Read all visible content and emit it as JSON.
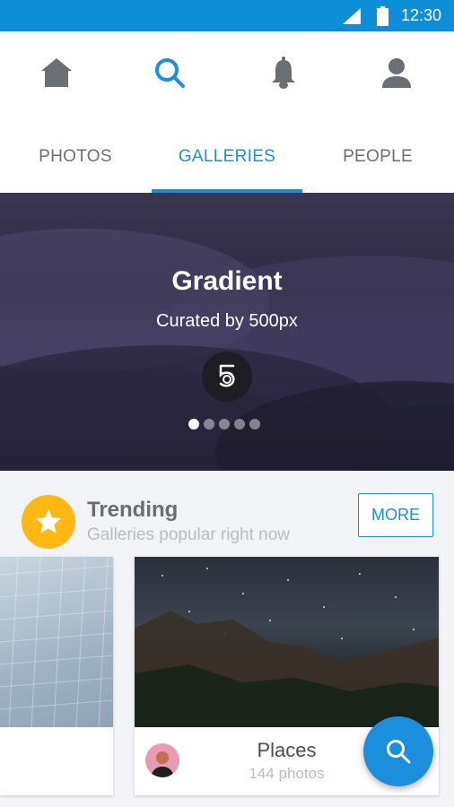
{
  "status_bar": {
    "time": "12:30",
    "icons": [
      "signal-icon",
      "battery-icon"
    ]
  },
  "nav": {
    "icons": [
      "home-icon",
      "search-icon",
      "bell-icon",
      "profile-icon"
    ],
    "active_icon": "search-icon",
    "tabs": [
      {
        "label": "PHOTOS"
      },
      {
        "label": "GALLERIES"
      },
      {
        "label": "PEOPLE"
      }
    ],
    "active_tab": "GALLERIES"
  },
  "hero": {
    "title": "Gradient",
    "subtitle": "Curated by 500px",
    "logo_icon": "500px-logo-icon",
    "carousel_total": 5,
    "carousel_active": 1
  },
  "trending": {
    "title": "Trending",
    "subtitle": "Galleries popular right now",
    "more_label": "MORE",
    "badge_icon": "star-icon",
    "cards": [
      {
        "title": "Places",
        "count": "144 photos"
      }
    ]
  },
  "fab": {
    "icon": "search-icon"
  },
  "colors": {
    "accent": "#1c8fdc",
    "status_bar": "#0f8ed8",
    "badge": "#fdb814"
  }
}
